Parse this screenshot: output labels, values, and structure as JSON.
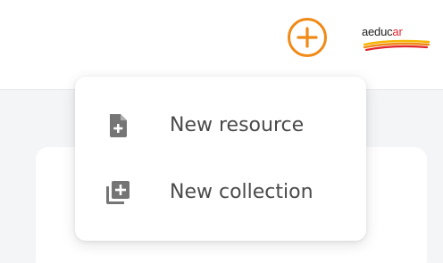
{
  "header": {
    "brand": {
      "main": "aeduc",
      "accent": "ar"
    },
    "create_button_icon": "plus-circle-icon"
  },
  "create_menu": {
    "items": [
      {
        "icon": "file-plus-icon",
        "label": "New resource"
      },
      {
        "icon": "library-add-icon",
        "label": "New collection"
      }
    ]
  },
  "colors": {
    "accent": "#f08a16",
    "brand_red": "#e2262e",
    "icon_gray": "#757575",
    "text": "#4a4a4a",
    "background": "#f4f5f7"
  }
}
